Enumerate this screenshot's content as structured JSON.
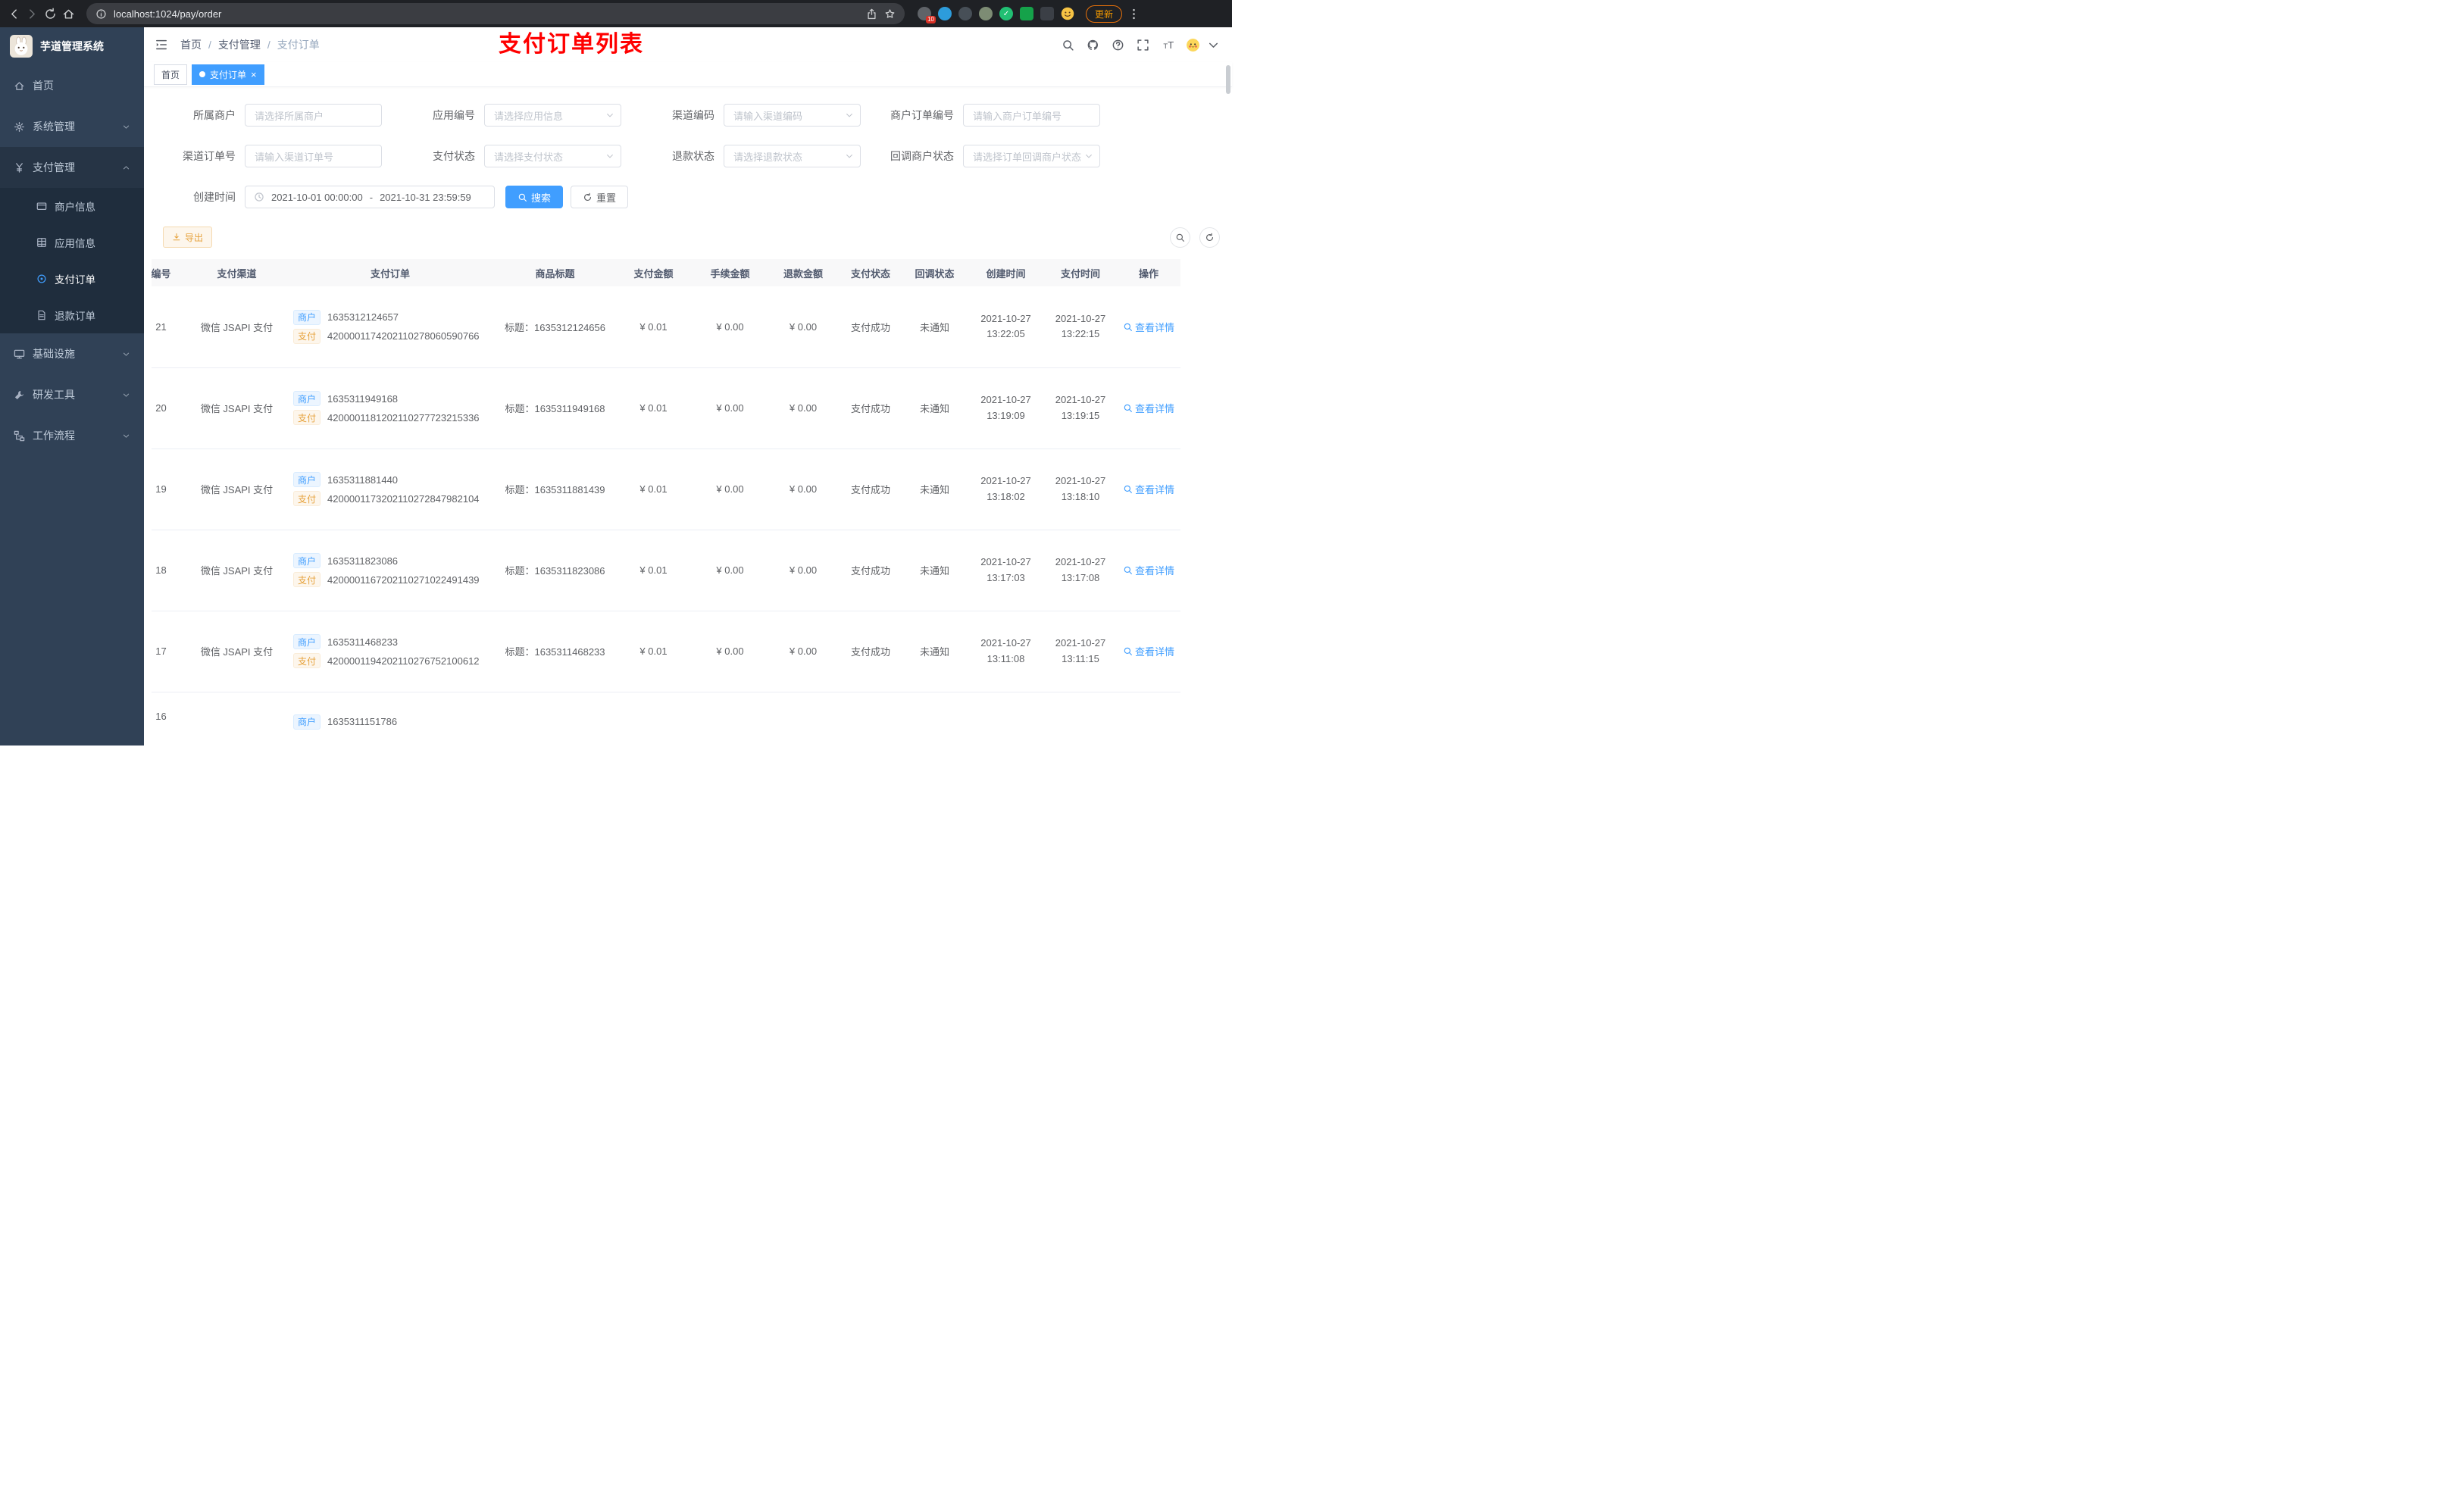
{
  "browser": {
    "url": "localhost:1024/pay/order",
    "badge": "10",
    "update_label": "更新"
  },
  "sidebar": {
    "logo_title": "芋道管理系统",
    "menu": [
      {
        "label": "首页",
        "icon": "home-icon",
        "type": "item"
      },
      {
        "label": "系统管理",
        "icon": "gear-icon",
        "type": "group",
        "arrow": "down"
      },
      {
        "label": "支付管理",
        "icon": "yen-icon",
        "type": "group",
        "arrow": "up",
        "expanded": true
      },
      {
        "label": "商户信息",
        "icon": "card-icon",
        "type": "sub"
      },
      {
        "label": "应用信息",
        "icon": "grid-icon",
        "type": "sub"
      },
      {
        "label": "支付订单",
        "icon": "target-icon",
        "type": "sub",
        "active": true
      },
      {
        "label": "退款订单",
        "icon": "doc-icon",
        "type": "sub"
      },
      {
        "label": "基础设施",
        "icon": "monitor-icon",
        "type": "group",
        "arrow": "down"
      },
      {
        "label": "研发工具",
        "icon": "tool-icon",
        "type": "group",
        "arrow": "down"
      },
      {
        "label": "工作流程",
        "icon": "flow-icon",
        "type": "group",
        "arrow": "down"
      }
    ]
  },
  "header": {
    "breadcrumb": [
      "首页",
      "支付管理",
      "支付订单"
    ],
    "annotation": "支付订单列表"
  },
  "tabs": [
    {
      "label": "首页",
      "active": false,
      "closable": false
    },
    {
      "label": "支付订单",
      "active": true,
      "closable": true
    }
  ],
  "filters": {
    "rows": [
      [
        {
          "label": "所属商户",
          "placeholder": "请选择所属商户",
          "type": "input"
        },
        {
          "label": "应用编号",
          "placeholder": "请选择应用信息",
          "type": "select"
        },
        {
          "label": "渠道编码",
          "placeholder": "请输入渠道编码",
          "type": "select"
        },
        {
          "label": "商户订单编号",
          "placeholder": "请输入商户订单编号",
          "type": "input"
        }
      ],
      [
        {
          "label": "渠道订单号",
          "placeholder": "请输入渠道订单号",
          "type": "input"
        },
        {
          "label": "支付状态",
          "placeholder": "请选择支付状态",
          "type": "select"
        },
        {
          "label": "退款状态",
          "placeholder": "请选择退款状态",
          "type": "select"
        },
        {
          "label": "回调商户状态",
          "placeholder": "请选择订单回调商户状态",
          "type": "select"
        }
      ]
    ],
    "date": {
      "label": "创建时间",
      "start": "2021-10-01 00:00:00",
      "separator": "-",
      "end": "2021-10-31 23:59:59"
    },
    "search_label": "搜索",
    "reset_label": "重置"
  },
  "toolbar": {
    "export_label": "导出"
  },
  "table": {
    "columns": [
      "编号",
      "支付渠道",
      "支付订单",
      "商品标题",
      "支付金额",
      "手续金额",
      "退款金额",
      "支付状态",
      "回调状态",
      "创建时间",
      "支付时间",
      "操作"
    ],
    "merchant_tag": "商户",
    "pay_tag": "支付",
    "action_label": "查看详情",
    "rows": [
      {
        "id": "21",
        "channel": "微信 JSAPI 支付",
        "merchant_no": "1635312124657",
        "pay_no": "4200001174202110278060590766",
        "title": "标题：1635312124656",
        "amount": "¥ 0.01",
        "fee": "¥ 0.00",
        "refund": "¥ 0.00",
        "status": "支付成功",
        "notify": "未通知",
        "create_date": "2021-10-27",
        "create_time": "13:22:05",
        "pay_date": "2021-10-27",
        "pay_time": "13:22:15"
      },
      {
        "id": "20",
        "channel": "微信 JSAPI 支付",
        "merchant_no": "1635311949168",
        "pay_no": "4200001181202110277723215336",
        "title": "标题：1635311949168",
        "amount": "¥ 0.01",
        "fee": "¥ 0.00",
        "refund": "¥ 0.00",
        "status": "支付成功",
        "notify": "未通知",
        "create_date": "2021-10-27",
        "create_time": "13:19:09",
        "pay_date": "2021-10-27",
        "pay_time": "13:19:15"
      },
      {
        "id": "19",
        "channel": "微信 JSAPI 支付",
        "merchant_no": "1635311881440",
        "pay_no": "4200001173202110272847982104",
        "title": "标题：1635311881439",
        "amount": "¥ 0.01",
        "fee": "¥ 0.00",
        "refund": "¥ 0.00",
        "status": "支付成功",
        "notify": "未通知",
        "create_date": "2021-10-27",
        "create_time": "13:18:02",
        "pay_date": "2021-10-27",
        "pay_time": "13:18:10"
      },
      {
        "id": "18",
        "channel": "微信 JSAPI 支付",
        "merchant_no": "1635311823086",
        "pay_no": "4200001167202110271022491439",
        "title": "标题：1635311823086",
        "amount": "¥ 0.01",
        "fee": "¥ 0.00",
        "refund": "¥ 0.00",
        "status": "支付成功",
        "notify": "未通知",
        "create_date": "2021-10-27",
        "create_time": "13:17:03",
        "pay_date": "2021-10-27",
        "pay_time": "13:17:08"
      },
      {
        "id": "17",
        "channel": "微信 JSAPI 支付",
        "merchant_no": "1635311468233",
        "pay_no": "4200001194202110276752100612",
        "title": "标题：1635311468233",
        "amount": "¥ 0.01",
        "fee": "¥ 0.00",
        "refund": "¥ 0.00",
        "status": "支付成功",
        "notify": "未通知",
        "create_date": "2021-10-27",
        "create_time": "13:11:08",
        "pay_date": "2021-10-27",
        "pay_time": "13:11:15"
      },
      {
        "id": "16",
        "channel": "",
        "merchant_no": "1635311151786",
        "pay_no": "",
        "title": "",
        "amount": "",
        "fee": "",
        "refund": "",
        "status": "",
        "notify": "",
        "create_date": "",
        "create_time": "",
        "pay_date": "",
        "pay_time": "",
        "partial": true
      }
    ]
  }
}
